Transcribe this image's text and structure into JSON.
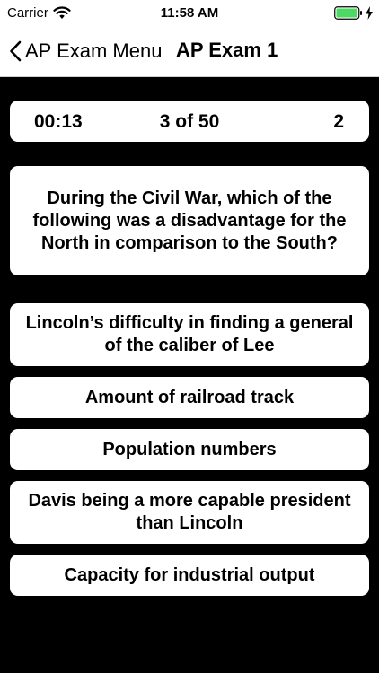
{
  "status_bar": {
    "carrier": "Carrier",
    "time": "11:58 AM",
    "icons": [
      "wifi-icon",
      "battery-icon",
      "bolt-icon"
    ],
    "battery_color": "#4cd964"
  },
  "nav": {
    "back_label": "AP Exam Menu",
    "title": "AP Exam 1"
  },
  "quiz": {
    "timer": "00:13",
    "progress": "3 of 50",
    "score": "2",
    "question": "During the Civil War, which of the following was a disadvantage for the North in comparison to the South?",
    "answers": [
      "Lincoln’s difficulty in finding a general of the caliber of Lee",
      "Amount of railroad track",
      "Population numbers",
      "Davis being a more capable president than Lincoln",
      "Capacity for industrial output"
    ]
  }
}
